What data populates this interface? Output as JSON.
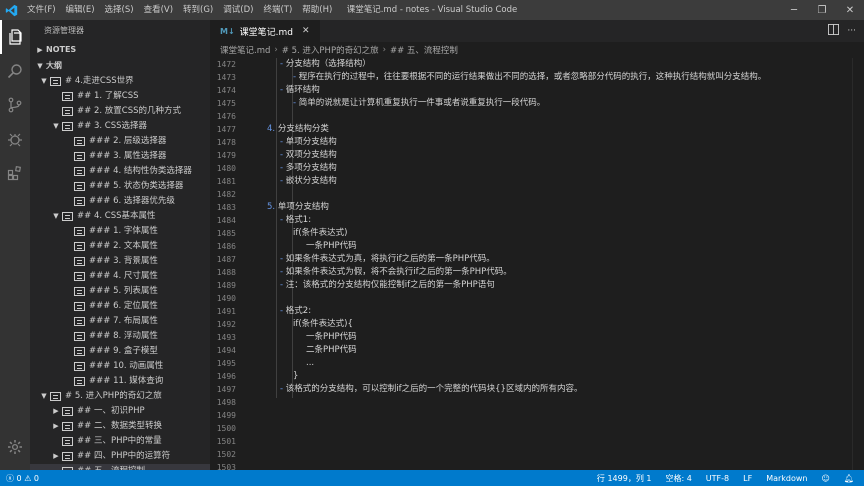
{
  "titlebar": {
    "menu": [
      "文件(F)",
      "编辑(E)",
      "选择(S)",
      "查看(V)",
      "转到(G)",
      "调试(D)",
      "终端(T)",
      "帮助(H)"
    ],
    "title": "课堂笔记.md - notes - Visual Studio Code"
  },
  "sidebar": {
    "header": "资源管理器",
    "notes_section": "NOTES",
    "outline_section": "大纲",
    "items": [
      {
        "label": "# 4.走进CSS世界",
        "level": 1,
        "caret": "down"
      },
      {
        "label": "## 1. 了解CSS",
        "level": 2,
        "caret": ""
      },
      {
        "label": "## 2. 放置CSS的几种方式",
        "level": 2,
        "caret": ""
      },
      {
        "label": "## 3. CSS选择器",
        "level": 2,
        "caret": "down"
      },
      {
        "label": "### 2. 层级选择器",
        "level": 3,
        "caret": ""
      },
      {
        "label": "### 3. 属性选择器",
        "level": 3,
        "caret": ""
      },
      {
        "label": "### 4. 结构性伪类选择器",
        "level": 3,
        "caret": ""
      },
      {
        "label": "### 5. 状态伪类选择器",
        "level": 3,
        "caret": ""
      },
      {
        "label": "### 6. 选择器优先级",
        "level": 3,
        "caret": ""
      },
      {
        "label": "## 4. CSS基本属性",
        "level": 2,
        "caret": "down"
      },
      {
        "label": "### 1. 字体属性",
        "level": 3,
        "caret": ""
      },
      {
        "label": "### 2. 文本属性",
        "level": 3,
        "caret": ""
      },
      {
        "label": "### 3. 背景属性",
        "level": 3,
        "caret": ""
      },
      {
        "label": "### 4. 尺寸属性",
        "level": 3,
        "caret": ""
      },
      {
        "label": "### 5. 列表属性",
        "level": 3,
        "caret": ""
      },
      {
        "label": "### 6. 定位属性",
        "level": 3,
        "caret": ""
      },
      {
        "label": "### 7. 布局属性",
        "level": 3,
        "caret": ""
      },
      {
        "label": "### 8. 浮动属性",
        "level": 3,
        "caret": ""
      },
      {
        "label": "### 9. 盒子模型",
        "level": 3,
        "caret": ""
      },
      {
        "label": "### 10. 动画属性",
        "level": 3,
        "caret": ""
      },
      {
        "label": "### 11. 媒体查询",
        "level": 3,
        "caret": ""
      },
      {
        "label": "# 5. 进入PHP的奇幻之旅",
        "level": 1,
        "caret": "down"
      },
      {
        "label": "## 一、初识PHP",
        "level": 2,
        "caret": "right"
      },
      {
        "label": "## 二、数据类型转换",
        "level": 2,
        "caret": "right"
      },
      {
        "label": "## 三、PHP中的常量",
        "level": 2,
        "caret": ""
      },
      {
        "label": "## 四、PHP中的运算符",
        "level": 2,
        "caret": "right"
      },
      {
        "label": "## 五、流程控制",
        "level": 2,
        "caret": "",
        "selected": true
      }
    ]
  },
  "editor": {
    "tab_label": "课堂笔记.md",
    "tab_icon": "M↓",
    "breadcrumb": [
      "课堂笔记.md",
      "# 5. 进入PHP的奇幻之旅",
      "## 五、流程控制"
    ],
    "lines": [
      {
        "n": "1472",
        "indent": 2,
        "mark": "- ",
        "text": "分支结构（选择结构）"
      },
      {
        "n": "1473",
        "indent": 3,
        "mark": "- ",
        "text": "程序在执行的过程中，往往要根据不同的运行结果做出不同的选择，或者忽略部分代码的执行，这种执行结构就叫分支结构。"
      },
      {
        "n": "1474",
        "indent": 2,
        "mark": "- ",
        "text": "循环结构"
      },
      {
        "n": "1475",
        "indent": 3,
        "mark": "- ",
        "text": "简单的说就是让计算机重复执行一件事或者说重复执行一段代码。"
      },
      {
        "n": "1476",
        "indent": 0,
        "mark": "",
        "text": ""
      },
      {
        "n": "1477",
        "indent": 1,
        "mark": "4. ",
        "text": "分支结构分类"
      },
      {
        "n": "1478",
        "indent": 2,
        "mark": "- ",
        "text": "单项分支结构"
      },
      {
        "n": "1479",
        "indent": 2,
        "mark": "- ",
        "text": "双项分支结构"
      },
      {
        "n": "1480",
        "indent": 2,
        "mark": "- ",
        "text": "多项分支结构"
      },
      {
        "n": "1481",
        "indent": 2,
        "mark": "- ",
        "text": "嵌状分支结构"
      },
      {
        "n": "1482",
        "indent": 0,
        "mark": "",
        "text": ""
      },
      {
        "n": "1483",
        "indent": 1,
        "mark": "5. ",
        "text": "单项分支结构"
      },
      {
        "n": "1484",
        "indent": 2,
        "mark": "- ",
        "text": "格式1:"
      },
      {
        "n": "1485",
        "indent": 3,
        "mark": "",
        "text": "if(条件表达式)"
      },
      {
        "n": "1486",
        "indent": 4,
        "mark": "",
        "text": "一条PHP代码"
      },
      {
        "n": "1487",
        "indent": 2,
        "mark": "- ",
        "text": "如果条件表达式为真，将执行if之后的第一条PHP代码。"
      },
      {
        "n": "1488",
        "indent": 2,
        "mark": "- ",
        "text": "如果条件表达式为假，将不会执行if之后的第一条PHP代码。"
      },
      {
        "n": "1489",
        "indent": 2,
        "mark": "- ",
        "text": "注：该格式的分支结构仅能控制if之后的第一条PHP语句"
      },
      {
        "n": "1490",
        "indent": 0,
        "mark": "",
        "text": ""
      },
      {
        "n": "1491",
        "indent": 2,
        "mark": "- ",
        "text": "格式2:"
      },
      {
        "n": "1492",
        "indent": 3,
        "mark": "",
        "text": "if(条件表达式){"
      },
      {
        "n": "1493",
        "indent": 4,
        "mark": "",
        "text": "一条PHP代码"
      },
      {
        "n": "1494",
        "indent": 4,
        "mark": "",
        "text": "二条PHP代码"
      },
      {
        "n": "1495",
        "indent": 4,
        "mark": "",
        "text": "..."
      },
      {
        "n": "1496",
        "indent": 3,
        "mark": "",
        "text": "}"
      },
      {
        "n": "1497",
        "indent": 2,
        "mark": "- ",
        "text": "该格式的分支结构，可以控制if之后的一个完整的代码块{}区域内的所有内容。"
      },
      {
        "n": "1498",
        "indent": 0,
        "mark": "",
        "text": ""
      },
      {
        "n": "1499",
        "indent": 0,
        "mark": "",
        "text": ""
      },
      {
        "n": "1500",
        "indent": 0,
        "mark": "",
        "text": ""
      },
      {
        "n": "1501",
        "indent": 0,
        "mark": "",
        "text": ""
      },
      {
        "n": "1502",
        "indent": 0,
        "mark": "",
        "text": ""
      },
      {
        "n": "1503",
        "indent": 0,
        "mark": "",
        "text": ""
      }
    ]
  },
  "statusbar": {
    "errors": "0",
    "warnings": "0",
    "position": "行 1499，列 1",
    "spaces": "空格: 4",
    "encoding": "UTF-8",
    "eol": "LF",
    "language": "Markdown"
  },
  "colors": {
    "accent": "#007acc",
    "list_marker": "#6796e6"
  }
}
